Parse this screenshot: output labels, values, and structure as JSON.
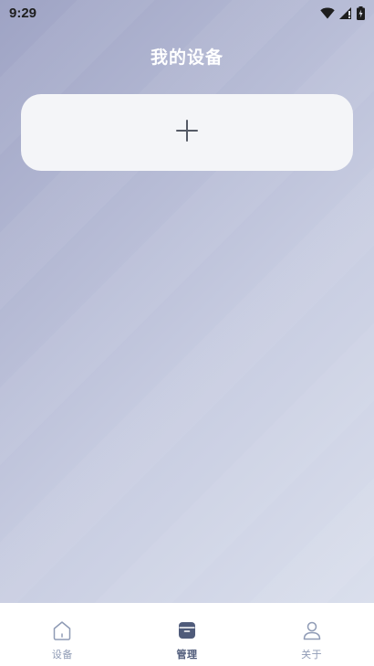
{
  "status_bar": {
    "time": "9:29",
    "icons": [
      "wifi-icon",
      "signal-icon",
      "battery-icon"
    ]
  },
  "header": {
    "title": "我的设备"
  },
  "add_card": {
    "icon": "plus-icon"
  },
  "bottom_nav": {
    "items": [
      {
        "label": "设备",
        "icon": "home-icon",
        "active": false
      },
      {
        "label": "管理",
        "icon": "box-icon",
        "active": true
      },
      {
        "label": "关于",
        "icon": "user-icon",
        "active": false
      }
    ]
  },
  "colors": {
    "nav_inactive": "#8f9bb5",
    "nav_active": "#4f5b7a",
    "card_bg": "#f4f5f8",
    "title_text": "#ffffff"
  }
}
